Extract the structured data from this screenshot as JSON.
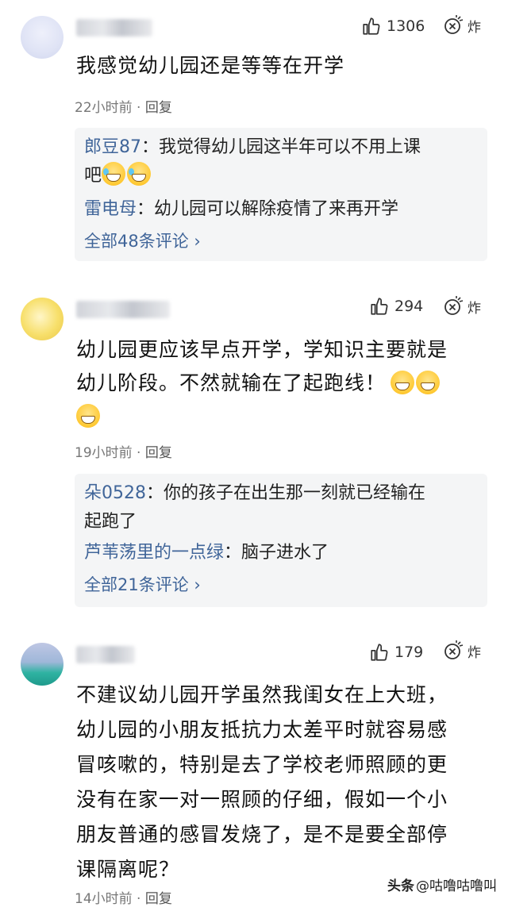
{
  "comments": [
    {
      "likes": "1306",
      "burst_label": "炸",
      "text": "我感觉幼儿园还是等等在开学",
      "time": "22小时前",
      "reply_label": "回复",
      "replies": [
        {
          "name": "郎豆87",
          "content_1": "我觉得幼儿园这半年可以不用上课",
          "content_2": "吧"
        },
        {
          "name": "雷电母",
          "content_1": "幼儿园可以解除疫情了来再开学"
        }
      ],
      "more": "全部48条评论 ›"
    },
    {
      "likes": "294",
      "burst_label": "炸",
      "text_1": "幼儿园更应该早点开学，学知识主要就是",
      "text_2": "幼儿阶段。不然就输在了起跑线！",
      "time": "19小时前",
      "reply_label": "回复",
      "replies": [
        {
          "name": "朵0528",
          "content_1": "你的孩子在出生那一刻就已经输在",
          "content_2": "起跑了"
        },
        {
          "name": "芦苇荡里的一点绿",
          "content_1": "脑子进水了"
        }
      ],
      "more": "全部21条评论 ›"
    },
    {
      "likes": "179",
      "burst_label": "炸",
      "text_lines": [
        "不建议幼儿园开学虽然我闺女在上大班，",
        "幼儿园的小朋友抵抗力太差平时就容易感",
        "冒咳嗽的，特别是去了学校老师照顾的更",
        "没有在家一对一照顾的仔细，假如一个小",
        "朋友普通的感冒发烧了，是不是要全部停",
        "课隔离呢？"
      ],
      "time": "14小时前",
      "reply_label": "回复"
    }
  ],
  "watermark": {
    "brand": "头条",
    "handle": "@咕噜咕噜叫"
  },
  "icons": {
    "like": "thumbs-up-icon",
    "burst": "burst-icon",
    "chevron": "chevron-right-icon"
  },
  "colors": {
    "link": "#406599",
    "reply_bg": "#f4f5f6"
  }
}
